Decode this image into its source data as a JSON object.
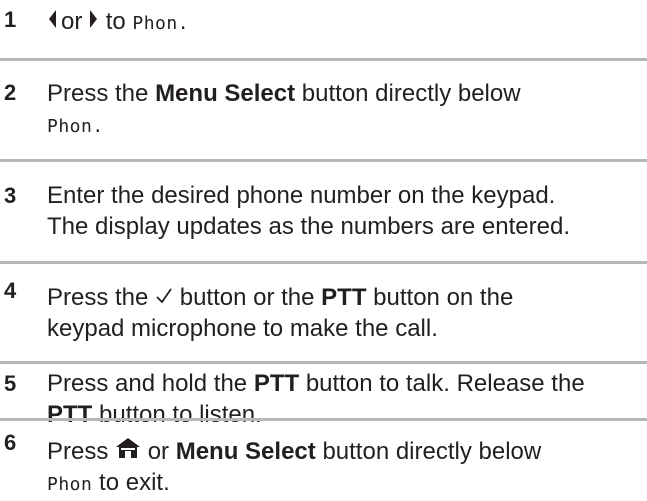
{
  "steps": [
    {
      "number": "1",
      "left_arrow_icon": "left-arrow-icon",
      "or": "or",
      "right_arrow_icon": "right-arrow-icon",
      "to": "to",
      "menu_item": "Phon."
    },
    {
      "number": "2",
      "press": "Press the",
      "button": "Menu Select",
      "rest": "button directly below",
      "menu_item": "Phon."
    },
    {
      "number": "3",
      "line1": "Enter the desired phone number on the keypad.",
      "line2": "The display updates as the numbers are entered."
    },
    {
      "number": "4",
      "press": "Press the",
      "check_icon": "checkmark-icon",
      "mid": "button or the",
      "button": "PTT",
      "rest": "button on the",
      "line2": "keypad microphone to make the call."
    },
    {
      "number": "5",
      "press": "Press and hold the",
      "button": "PTT",
      "rest": "button to talk. Release the",
      "button2": "PTT",
      "rest2": "button to listen."
    },
    {
      "number": "6",
      "press": "Press",
      "home_icon": "home-icon",
      "or": "or",
      "button": "Menu Select",
      "rest": "button directly below",
      "menu_item": "Phon",
      "rest2": "to exit."
    }
  ],
  "colors": {
    "text": "#231f20",
    "divider": "#b3b9b7"
  }
}
